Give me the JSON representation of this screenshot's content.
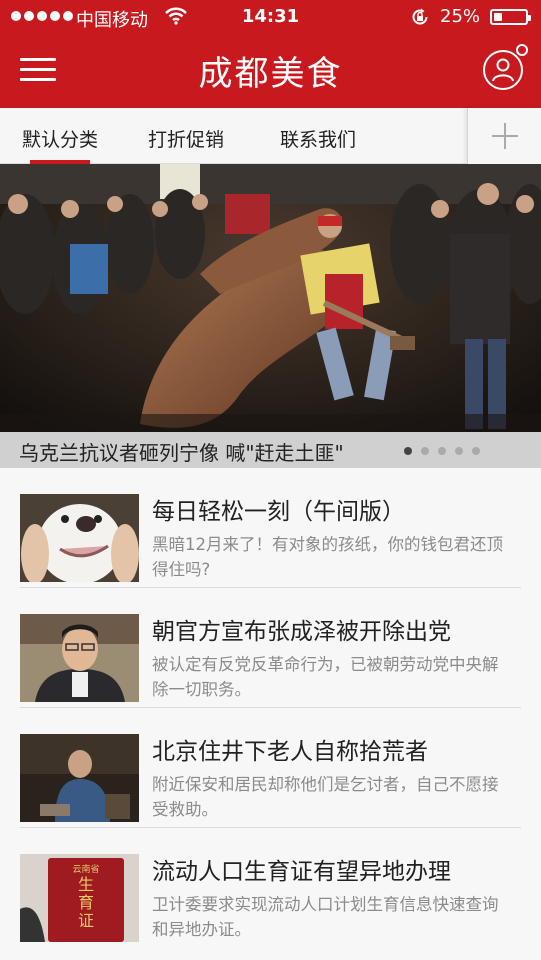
{
  "status_bar": {
    "carrier": "中国移动",
    "time": "14:31",
    "battery_percent": "25%",
    "battery_level": 0.25
  },
  "header": {
    "title": "成都美食",
    "menu_icon": "hamburger-menu-icon",
    "user_icon": "user-profile-icon"
  },
  "tabs": [
    {
      "label": "默认分类",
      "active": true
    },
    {
      "label": "打折促销",
      "active": false
    },
    {
      "label": "联系我们",
      "active": false
    }
  ],
  "add_tab_icon": "plus-icon",
  "hero": {
    "caption": "乌克兰抗议者砸列宁像 喊\"赶走土匪\"",
    "page_count": 5,
    "current_page": 1
  },
  "news": [
    {
      "title": "每日轻松一刻（午间版）",
      "desc": "黑暗12月来了！有对象的孩纸，你的钱包君还顶得住吗?"
    },
    {
      "title": "朝官方宣布张成泽被开除出党",
      "desc": "被认定有反党反革命行为，已被朝劳动党中央解除一切职务。"
    },
    {
      "title": "北京住井下老人自称拾荒者",
      "desc": "附近保安和居民却称他们是乞讨者，自己不愿接受救助。"
    },
    {
      "title": "流动人口生育证有望异地办理",
      "desc": "卫计委要求实现流动人口计划生育信息快速查询和异地办证。"
    }
  ],
  "thumb4_text": {
    "line1": "云南省",
    "line2": "生",
    "line3": "育",
    "line4": "证"
  },
  "colors": {
    "brand_red": "#c8191f",
    "text_dark": "#222222",
    "text_gray": "#8b8b8b"
  }
}
